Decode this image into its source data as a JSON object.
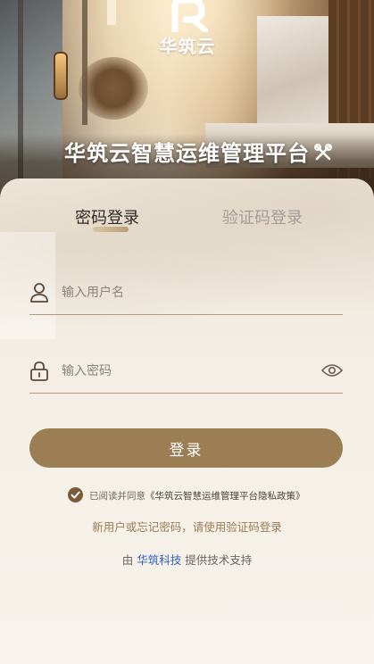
{
  "app": {
    "brand": "华筑云",
    "platform_title": "华筑云智慧运维管理平台"
  },
  "tabs": [
    {
      "label": "密码登录",
      "active": true
    },
    {
      "label": "验证码登录",
      "active": false
    }
  ],
  "form": {
    "username_placeholder": "输入用户名",
    "username_value": "",
    "password_placeholder": "输入密码",
    "password_value": "",
    "login_label": "登录"
  },
  "agreement": {
    "checked": true,
    "prefix": "已阅读并同意",
    "policy": "《华筑云智慧运维管理平台隐私政策》"
  },
  "hint": "新用户或忘记密码，请使用验证码登录",
  "support": {
    "prefix": "由",
    "company": "华筑科技",
    "suffix": "提供技术支持"
  },
  "colors": {
    "accent": "#9c7e55",
    "link": "#2f5fc6",
    "checkbox": "#7a5b37"
  },
  "icons": [
    "logo-mark-icon",
    "tools-icon",
    "user-icon",
    "lock-icon",
    "eye-icon",
    "check-icon"
  ]
}
